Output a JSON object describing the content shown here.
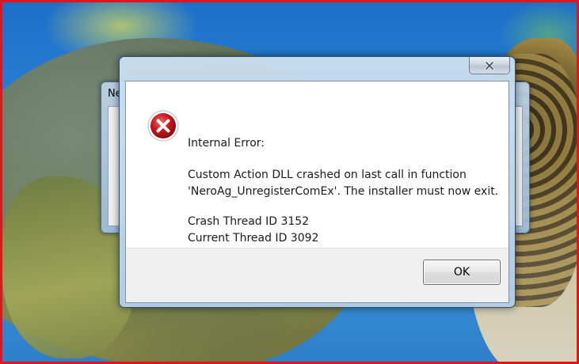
{
  "background_window": {
    "title_fragment": "Ne"
  },
  "dialog": {
    "icon": "error-icon",
    "heading": "Internal Error:",
    "message_line1": "Custom Action DLL crashed on last call in function",
    "message_line2": "'NeroAg_UnregisterComEx'. The installer must now exit.",
    "crash_thread": "Crash Thread ID 3152",
    "current_thread": "Current Thread ID 3092",
    "ok_label": "OK",
    "close_icon": "close-icon"
  },
  "colors": {
    "screen_border": "#e3151a",
    "error_red": "#c8161d"
  }
}
